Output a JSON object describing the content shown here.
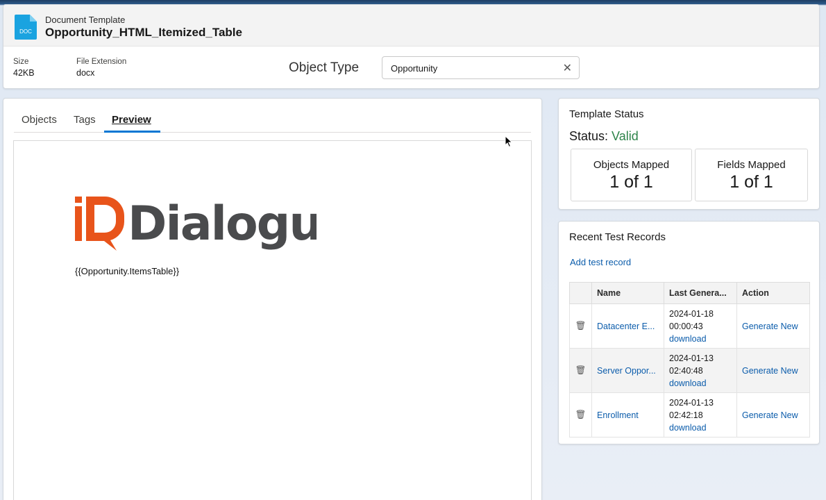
{
  "header": {
    "kind": "Document Template",
    "title": "Opportunity_HTML_Itemized_Table",
    "icon": "doc-file-icon",
    "icon_text": "DOC",
    "size_label": "Size",
    "size_value": "42KB",
    "ext_label": "File Extension",
    "ext_value": "docx",
    "object_type_label": "Object Type",
    "object_type_value": "Opportunity"
  },
  "tabs": [
    {
      "label": "Objects"
    },
    {
      "label": "Tags"
    },
    {
      "label": "Preview",
      "active": true
    }
  ],
  "preview": {
    "logo_text": "Dialogue",
    "logo_mark": "iD",
    "merge_field": "{{Opportunity.ItemsTable}}"
  },
  "status": {
    "title": "Template Status",
    "status_prefix": "Status:",
    "status_value": "Valid",
    "objects_label": "Objects Mapped",
    "objects_value": "1 of 1",
    "fields_label": "Fields Mapped",
    "fields_value": "1 of 1"
  },
  "records": {
    "title": "Recent Test Records",
    "add_link": "Add test record",
    "columns": [
      "Name",
      "Last Genera...",
      "Action"
    ],
    "rows": [
      {
        "name": "Datacenter E...",
        "date": "2024-01-18",
        "time": "00:00:43",
        "download": "download",
        "action": "Generate New"
      },
      {
        "name": "Server Oppor...",
        "date": "2024-01-13",
        "time": "02:40:48",
        "download": "download",
        "action": "Generate New"
      },
      {
        "name": "Enrollment",
        "date": "2024-01-13",
        "time": "02:42:18",
        "download": "download",
        "action": "Generate New"
      }
    ]
  },
  "colors": {
    "accent": "#0176d3",
    "valid": "#2e844a",
    "link": "#0b5cab",
    "logo_orange": "#e8541b",
    "logo_gray": "#4a4b4d",
    "doc_icon": "#1aa3e0"
  }
}
